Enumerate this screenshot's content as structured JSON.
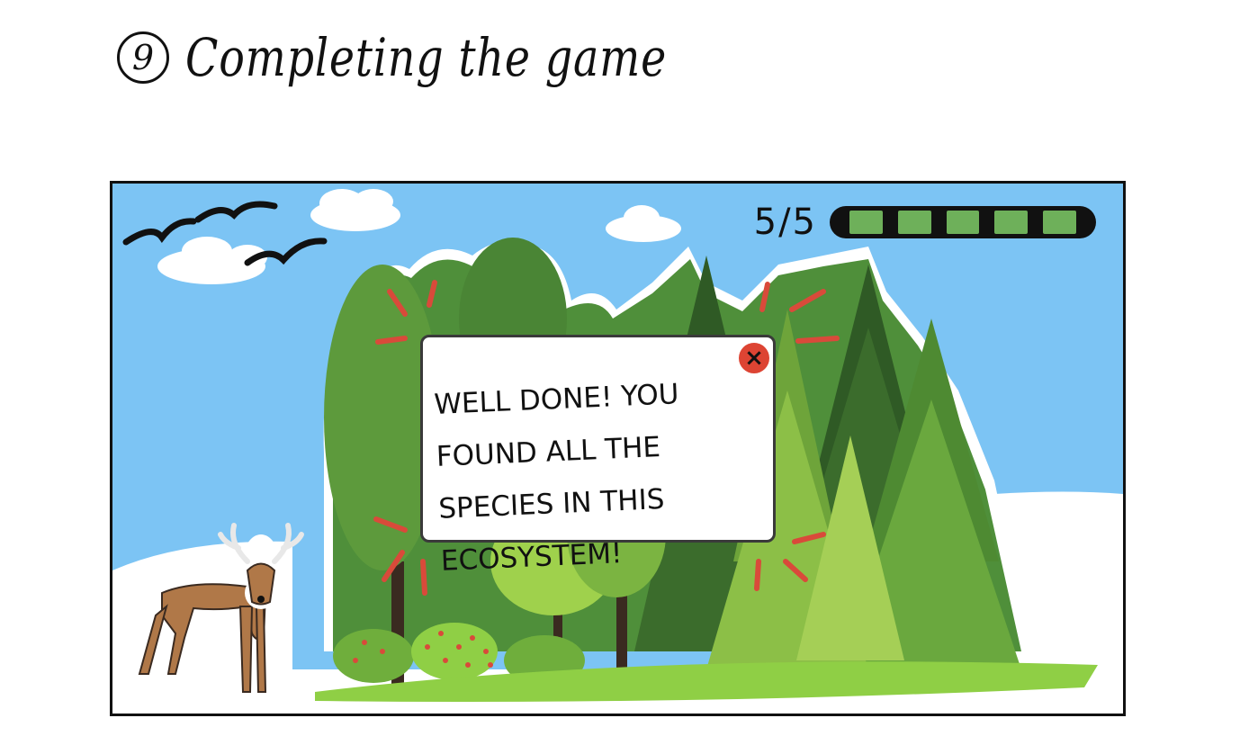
{
  "heading": {
    "step_number": "9",
    "title": "Completing the game"
  },
  "hud": {
    "score": "5/5",
    "progress": {
      "found": 5,
      "total": 5
    },
    "progress_color": "#6eb05a"
  },
  "dialog": {
    "message": "WELL DONE! YOU FOUND ALL THE SPECIES IN THIS ECOSYSTEM!",
    "close_label": "×",
    "close_icon": "close-icon",
    "ray_color": "#d94a3a"
  },
  "scene": {
    "sky_color": "#7cc4f4",
    "ground_color": "#8fcf45"
  }
}
